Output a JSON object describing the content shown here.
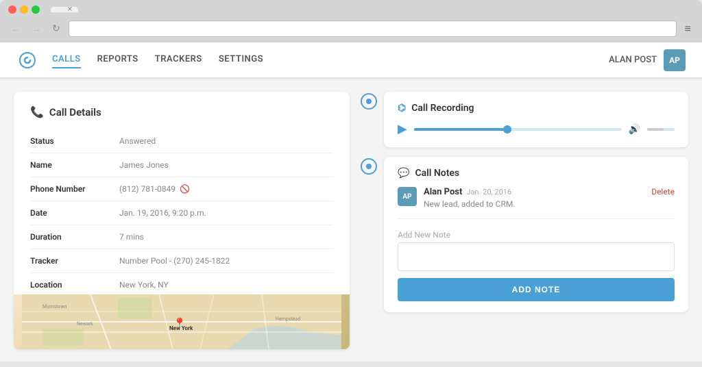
{
  "browser": {
    "tab_label": "",
    "back_label": "←",
    "forward_label": "→",
    "refresh_label": "↻",
    "menu_label": "≡"
  },
  "nav": {
    "logo_text": "C",
    "links": [
      {
        "id": "calls",
        "label": "CALLS",
        "active": true
      },
      {
        "id": "reports",
        "label": "REPORTS",
        "active": false
      },
      {
        "id": "trackers",
        "label": "TRACKERS",
        "active": false
      },
      {
        "id": "settings",
        "label": "SETTINGS",
        "active": false
      }
    ],
    "user_name": "ALAN POST",
    "user_initials": "AP"
  },
  "call_details": {
    "title": "Call Details",
    "fields": [
      {
        "label": "Status",
        "value": "Answered",
        "has_block": false
      },
      {
        "label": "Name",
        "value": "James Jones",
        "has_block": false
      },
      {
        "label": "Phone Number",
        "value": "(812) 781-0849",
        "has_block": true
      },
      {
        "label": "Date",
        "value": "Jan. 19, 2016, 9:20 p.m.",
        "has_block": false
      },
      {
        "label": "Duration",
        "value": "7 mins",
        "has_block": false
      },
      {
        "label": "Tracker",
        "value": "Number Pool - (270) 245-1822",
        "has_block": false
      },
      {
        "label": "Location",
        "value": "New York, NY",
        "has_block": false
      }
    ]
  },
  "call_recording": {
    "title": "Call Recording",
    "progress_percent": 45,
    "volume_percent": 60
  },
  "call_notes": {
    "title": "Call Notes",
    "notes": [
      {
        "author": "Alan Post",
        "initials": "AP",
        "date": "Jan. 20, 2016",
        "text": "New lead, added to CRM.",
        "delete_label": "Delete"
      }
    ],
    "add_note_placeholder": "Add New Note",
    "add_note_button": "ADD NOTE"
  }
}
